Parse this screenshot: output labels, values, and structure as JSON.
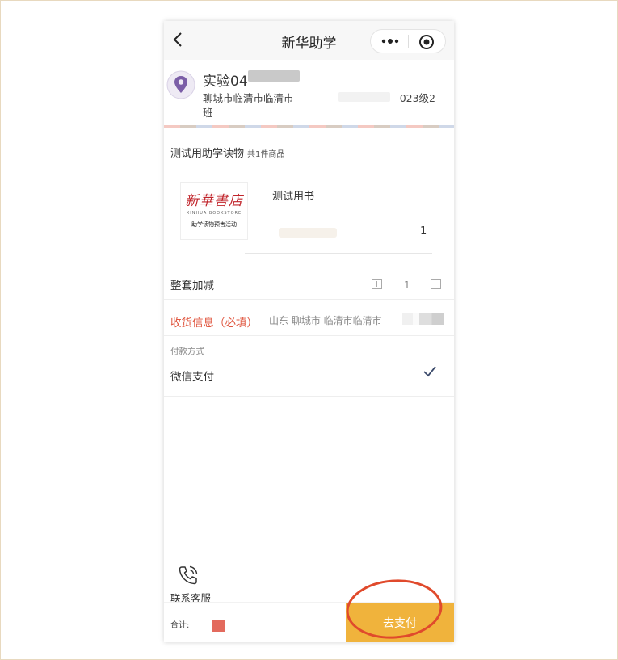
{
  "nav": {
    "title": "新华助学",
    "back_icon": "chevron-left-icon",
    "more_icon": "more-dots-icon",
    "target_icon": "target-icon"
  },
  "address": {
    "name_visible": "实验04",
    "line1": "聊城市临清市临清市",
    "line2": "班",
    "class_suffix": "023级2",
    "pin_icon": "location-pin-icon",
    "pin_color": "#7b5ea7"
  },
  "order": {
    "section_title": "测试用助学读物",
    "item_count": "共1件商品",
    "product": {
      "logo_cn": "新華書店",
      "logo_en": "XINHUA BOOKSTORE",
      "logo_sub": "助学读物预售活动",
      "name": "测试用书",
      "quantity": "1"
    }
  },
  "set_adjust": {
    "label": "整套加减",
    "value": "1"
  },
  "shipping": {
    "label": "收货信息（必填）",
    "value": "山东 聊城市 临清市临清市",
    "label_color": "#e0563f"
  },
  "payment": {
    "caption": "付款方式",
    "method": "微信支付"
  },
  "footer": {
    "service_label": "联系客服",
    "total_label": "合计:",
    "pay_button": "去支付",
    "pay_button_color": "#f0b33c",
    "annotation_color": "#e04a2c"
  }
}
